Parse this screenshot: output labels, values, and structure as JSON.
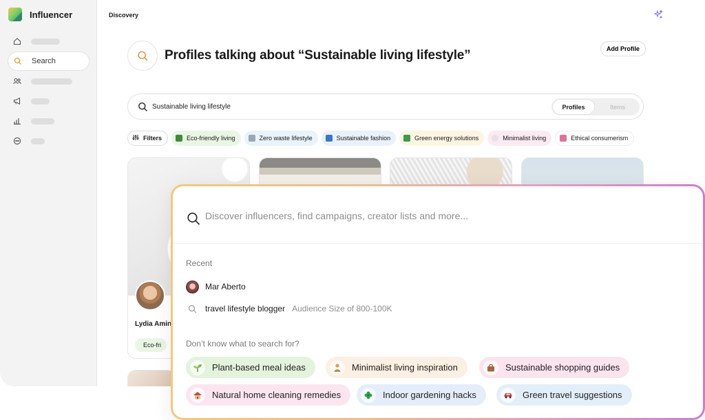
{
  "app": {
    "name": "Influencer"
  },
  "sidebar": {
    "items": [
      {
        "icon": "home-icon",
        "label": ""
      },
      {
        "icon": "search-icon",
        "label": "Search"
      },
      {
        "icon": "users-icon",
        "label": ""
      },
      {
        "icon": "megaphone-icon",
        "label": ""
      },
      {
        "icon": "bar-chart-icon",
        "label": ""
      },
      {
        "icon": "chat-icon",
        "label": ""
      }
    ]
  },
  "header": {
    "breadcrumb": "Discovery",
    "title": "Profiles talking about “Sustainable living lifestyle”",
    "add_profile_label": "Add Profile"
  },
  "search": {
    "value": "Sustainable living lifestyle",
    "toggle": {
      "selected": "Profiles",
      "other": "Items"
    }
  },
  "filters": {
    "label": "Filters",
    "chips": [
      {
        "label": "Eco-friendly living",
        "bg": "#eaf6e4",
        "icon_color": "#3e8d3a"
      },
      {
        "label": "Zero waste lifestyle",
        "bg": "#e8f3fb",
        "icon_color": "#9aa7b3"
      },
      {
        "label": "Sustainable fashion",
        "bg": "#e9f1fb",
        "icon_color": "#3a78c9"
      },
      {
        "label": "Green energy solutions",
        "bg": "#fbf5e2",
        "icon_color": "#3b9c4a"
      },
      {
        "label": "Minimalist living",
        "bg": "#fbeaf1",
        "icon_color": "#e3e3e3"
      },
      {
        "label": "Ethical consumerism",
        "bg": "#ffffff",
        "icon_color": "#e2709a"
      }
    ]
  },
  "cards": [
    {
      "name": "Lydia Amin",
      "tag": "Eco-fri"
    }
  ],
  "overlay": {
    "placeholder": "Discover influencers, find campaigns, creator lists and more...",
    "recent_label": "Recent",
    "recent": [
      {
        "type": "profile",
        "text": "Mar Aberto",
        "sub": ""
      },
      {
        "type": "query",
        "text": "travel lifestyle blogger",
        "sub": "Audience Size of 800-100K"
      }
    ],
    "hint": "Don’t know what to search for?",
    "suggestions": [
      {
        "label": "Plant-based meal ideas",
        "icon": "seedling-icon",
        "bg": "#e4f3dc"
      },
      {
        "label": "Minimalist living inspiration",
        "icon": "person-icon",
        "bg": "#fcefe3"
      },
      {
        "label": "Sustainable shopping guides",
        "icon": "handbag-icon",
        "bg": "#fbe4ee"
      },
      {
        "label": "Natural home cleaning remedies",
        "icon": "house-icon",
        "bg": "#fbe6f0"
      },
      {
        "label": "Indoor gardening hacks",
        "icon": "clover-icon",
        "bg": "#e4eefa"
      },
      {
        "label": "Green travel suggestions",
        "icon": "car-icon",
        "bg": "#e3eff8"
      }
    ]
  }
}
